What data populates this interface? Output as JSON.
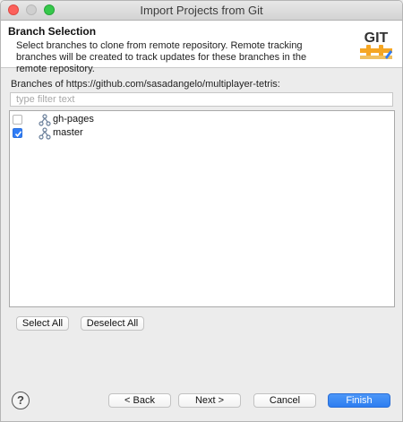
{
  "window": {
    "title": "Import Projects from Git"
  },
  "header": {
    "title": "Branch Selection",
    "description": "Select branches to clone from remote repository. Remote tracking branches will be created to track updates for these branches in the remote repository.",
    "logo_text": "GIT"
  },
  "branches_label": "Branches of https://github.com/sasadangelo/multiplayer-tetris:",
  "filter": {
    "placeholder": "type filter text",
    "value": ""
  },
  "branches": [
    {
      "name": "gh-pages",
      "checked": false
    },
    {
      "name": "master",
      "checked": true
    }
  ],
  "selection_buttons": {
    "select_all": "Select All",
    "deselect_all": "Deselect All"
  },
  "footer": {
    "help": "?",
    "back": "< Back",
    "next": "Next >",
    "cancel": "Cancel",
    "finish": "Finish"
  },
  "colors": {
    "accent": "#2f7cf6",
    "logo_orange": "#f5a623"
  }
}
